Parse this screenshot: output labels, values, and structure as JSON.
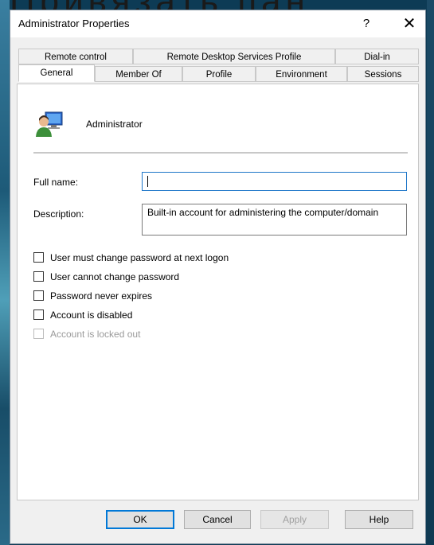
{
  "background": {
    "top_text": "Привязать пан"
  },
  "window": {
    "title": "Administrator Properties",
    "help_label": "?",
    "close_label": "✕"
  },
  "tabs": {
    "row1": [
      "Remote control",
      "Remote Desktop Services Profile",
      "Dial-in"
    ],
    "row2": [
      "General",
      "Member Of",
      "Profile",
      "Environment",
      "Sessions"
    ],
    "active": "General"
  },
  "general": {
    "user_name": "Administrator",
    "full_name_label": "Full name:",
    "full_name_value": "",
    "description_label": "Description:",
    "description_value": "Built-in account for administering the computer/domain",
    "checkboxes": [
      {
        "label": "User must change password at next logon",
        "checked": false,
        "enabled": true
      },
      {
        "label": "User cannot change password",
        "checked": false,
        "enabled": true
      },
      {
        "label": "Password never expires",
        "checked": false,
        "enabled": true
      },
      {
        "label": "Account is disabled",
        "checked": false,
        "enabled": true
      },
      {
        "label": "Account is locked out",
        "checked": false,
        "enabled": false
      }
    ]
  },
  "buttons": {
    "ok": "OK",
    "cancel": "Cancel",
    "apply": "Apply",
    "help": "Help"
  },
  "colors": {
    "focus_border": "#1e76c8",
    "default_button_border": "#0078d7"
  }
}
